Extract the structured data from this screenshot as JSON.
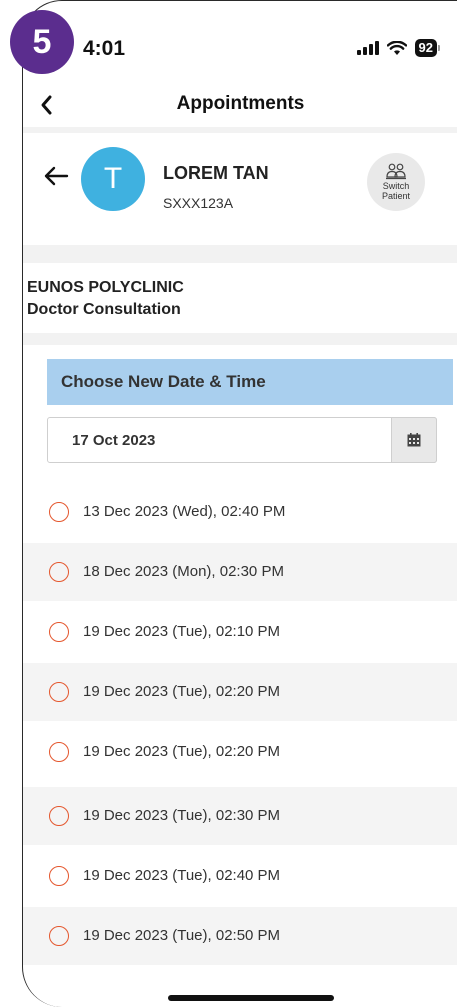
{
  "step_badge": "5",
  "status_bar": {
    "time": "4:01",
    "battery": "92",
    "icons": [
      "signal-icon",
      "wifi-icon",
      "battery-icon"
    ]
  },
  "nav": {
    "title": "Appointments",
    "back_icon": "chevron-left-icon"
  },
  "patient": {
    "initial": "T",
    "name": "LOREM TAN",
    "id": "SXXX123A",
    "switch_label_line1": "Switch",
    "switch_label_line2": "Patient",
    "avatar_color": "#3fb1e0"
  },
  "appointment": {
    "clinic": "EUNOS POLYCLINIC",
    "service": "Doctor Consultation"
  },
  "date_picker": {
    "header": "Choose New Date & Time",
    "selected_date": "17 Oct 2023",
    "header_color": "#a9cfee"
  },
  "slots": [
    "13 Dec 2023 (Wed), 02:40 PM",
    "18 Dec 2023 (Mon), 02:30 PM",
    "19 Dec 2023 (Tue), 02:10 PM",
    "19 Dec 2023 (Tue), 02:20 PM",
    "19 Dec 2023 (Tue), 02:20 PM",
    "19 Dec 2023 (Tue), 02:30 PM",
    "19 Dec 2023 (Tue), 02:40 PM",
    "19 Dec 2023 (Tue), 02:50 PM"
  ],
  "colors": {
    "badge": "#5b2d8e",
    "radio_border": "#e4572e"
  }
}
